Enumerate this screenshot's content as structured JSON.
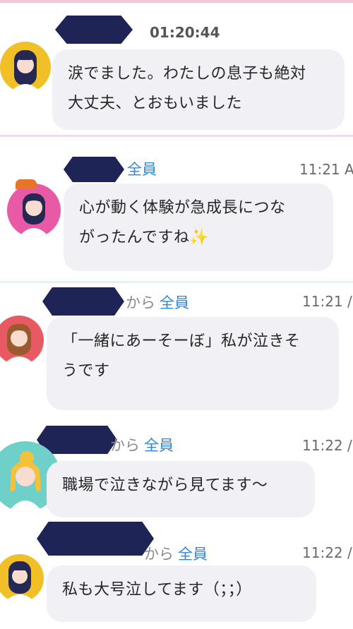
{
  "messages": [
    {
      "time": "01:20:44",
      "text": "涙でました。わたしの息子も絶対大丈夫、とおもいました",
      "line1": "涙でました。わたしの息子も絶対",
      "line2": "大丈夫、とおもいました",
      "avatar_bg": "#f0c026"
    },
    {
      "to": "全員",
      "time": "11:21 A",
      "line1": "心が動く体験が急成長につな",
      "line2": "がったんですね",
      "emoji": "✨",
      "avatar_bg": "#e85aa6"
    },
    {
      "from": "から",
      "to": "全員",
      "time": "11:21 /",
      "line1": "「一緒にあーそーぼ」私が泣きそ",
      "line2": "うです",
      "avatar_bg": "#e85a63"
    },
    {
      "from": "から",
      "to": "全員",
      "time": "11:22 /",
      "line1": "職場で泣きながら見てます～",
      "avatar_bg": "#6fcfc9"
    },
    {
      "from": "から",
      "to": "全員",
      "time": "11:22 /",
      "line1": "私も大号泣してます（；；）",
      "avatar_bg": "#f0c026"
    }
  ]
}
